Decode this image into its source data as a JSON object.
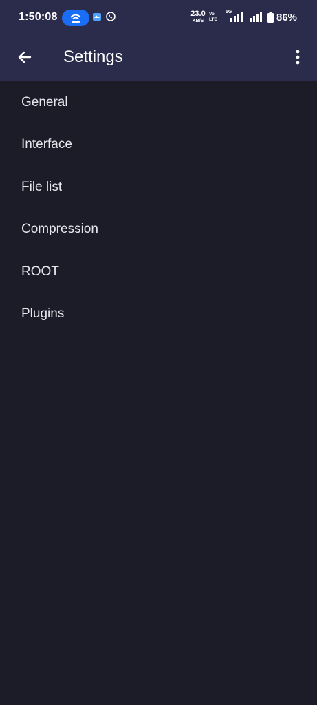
{
  "status_bar": {
    "time": "1:50:08",
    "net_speed_value": "23.0",
    "net_speed_unit": "KB/S",
    "volte_label": "Vo LTE",
    "network_label": "5G",
    "battery_percent": "86%",
    "hotspot_color": "#1a6ef5"
  },
  "app_bar": {
    "title": "Settings",
    "back_icon": "arrow-left-icon",
    "menu_icon": "more-vert-icon"
  },
  "settings": {
    "items": [
      {
        "label": "General"
      },
      {
        "label": "Interface"
      },
      {
        "label": "File list"
      },
      {
        "label": "Compression"
      },
      {
        "label": "ROOT"
      },
      {
        "label": "Plugins"
      }
    ]
  },
  "colors": {
    "background": "#1b1c27",
    "app_bar": "#2b2c4b",
    "text": "#e6e6ec"
  }
}
